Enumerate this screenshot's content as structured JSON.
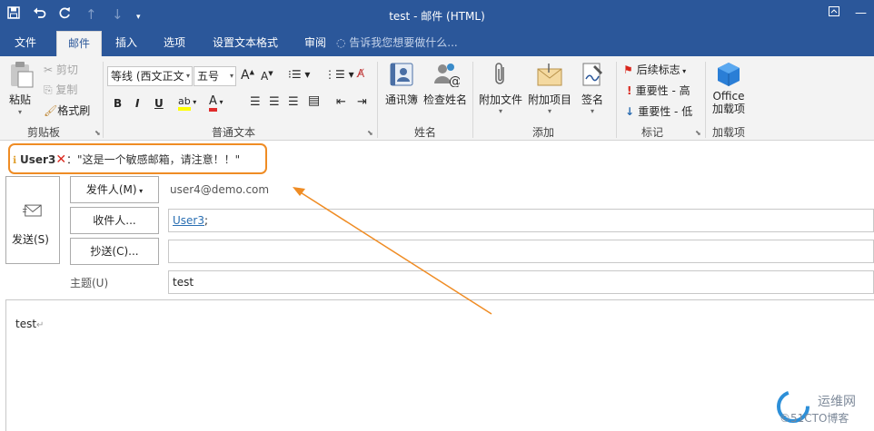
{
  "window": {
    "title": "test - 邮件 (HTML)"
  },
  "tabs": [
    {
      "label": "文件"
    },
    {
      "label": "邮件"
    },
    {
      "label": "插入"
    },
    {
      "label": "选项"
    },
    {
      "label": "设置文本格式"
    },
    {
      "label": "审阅"
    }
  ],
  "tell_me": "告诉我您想要做什么...",
  "ribbon": {
    "clipboard": {
      "paste": "粘贴",
      "cut": "剪切",
      "copy": "复制",
      "format_painter": "格式刷",
      "label": "剪贴板"
    },
    "basic_text": {
      "font": "等线 (西文正文",
      "size": "五号",
      "bold": "B",
      "italic": "I",
      "underline": "U",
      "label": "普通文本"
    },
    "names": {
      "address_book": "通讯簿",
      "check_names": "检查姓名",
      "label": "姓名"
    },
    "include": {
      "attach_file": "附加文件",
      "attach_item": "附加项目",
      "signature": "签名",
      "label": "添加"
    },
    "tags": {
      "follow_up": "后续标志",
      "high": "重要性 - 高",
      "low": "重要性 - 低",
      "label": "标记"
    },
    "addins": {
      "office_line1": "Office",
      "office_line2": "加载项",
      "label": "加载项"
    }
  },
  "alert": {
    "user": "User3",
    "message": "：\"这是一个敏感邮箱，请注意！！\""
  },
  "compose": {
    "send_label": "发送(S)",
    "from_button": "发件人(M)",
    "from_value": "user4@demo.com",
    "to_button": "收件人...",
    "to_value": "User3",
    "to_suffix": ";",
    "cc_button": "抄送(C)...",
    "cc_value": "",
    "subject_label": "主题(U)",
    "subject_value": "test",
    "body_text": "test"
  },
  "watermark": {
    "line1": "运维网",
    "line2": "©51CTO博客"
  },
  "colors": {
    "titlebar": "#2b579a",
    "alert_border": "#ef8c24",
    "arrow": "#ef8c24",
    "link": "#2a6fb3"
  }
}
